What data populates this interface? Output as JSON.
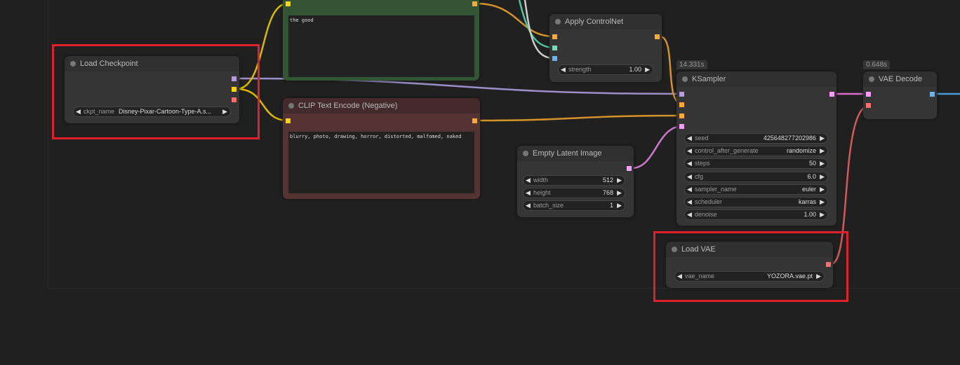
{
  "nodes": {
    "load_checkpoint": {
      "title": "Load Checkpoint",
      "widgets": [
        {
          "label": "ckpt_name",
          "value": "Disney-Pixar-Cartoon-Type-A.s..."
        }
      ]
    },
    "positive": {
      "text": "the good"
    },
    "negative": {
      "title": "CLIP Text Encode (Negative)",
      "text": "blurry, photo, drawing, horror, distorted, malfomed, naked"
    },
    "apply_controlnet": {
      "title": "Apply ControlNet",
      "widgets": [
        {
          "label": "strength",
          "value": "1.00"
        }
      ]
    },
    "ksampler": {
      "title": "KSampler",
      "time": "14.331s",
      "widgets": [
        {
          "label": "seed",
          "value": "425648277202986"
        },
        {
          "label": "control_after_generate",
          "value": "randomize"
        },
        {
          "label": "steps",
          "value": "50"
        },
        {
          "label": "cfg",
          "value": "6.0"
        },
        {
          "label": "sampler_name",
          "value": "euler"
        },
        {
          "label": "scheduler",
          "value": "karras"
        },
        {
          "label": "denoise",
          "value": "1.00"
        }
      ]
    },
    "vae_decode": {
      "title": "VAE Decode",
      "time": "0.648s"
    },
    "empty_latent": {
      "title": "Empty Latent Image",
      "widgets": [
        {
          "label": "width",
          "value": "512"
        },
        {
          "label": "height",
          "value": "768"
        },
        {
          "label": "batch_size",
          "value": "1"
        }
      ]
    },
    "load_vae": {
      "title": "Load VAE",
      "widgets": [
        {
          "label": "vae_name",
          "value": "YOZORA.vae.pt"
        }
      ]
    }
  },
  "colors": {
    "model": "#b39ddb",
    "clip": "#ffd500",
    "vae": "#ff6e6e",
    "conditioning": "#ffa931",
    "latent": "#ff9cf9",
    "image": "#64b5f6",
    "control": "#00d78d",
    "highlight": "#e0202a"
  }
}
